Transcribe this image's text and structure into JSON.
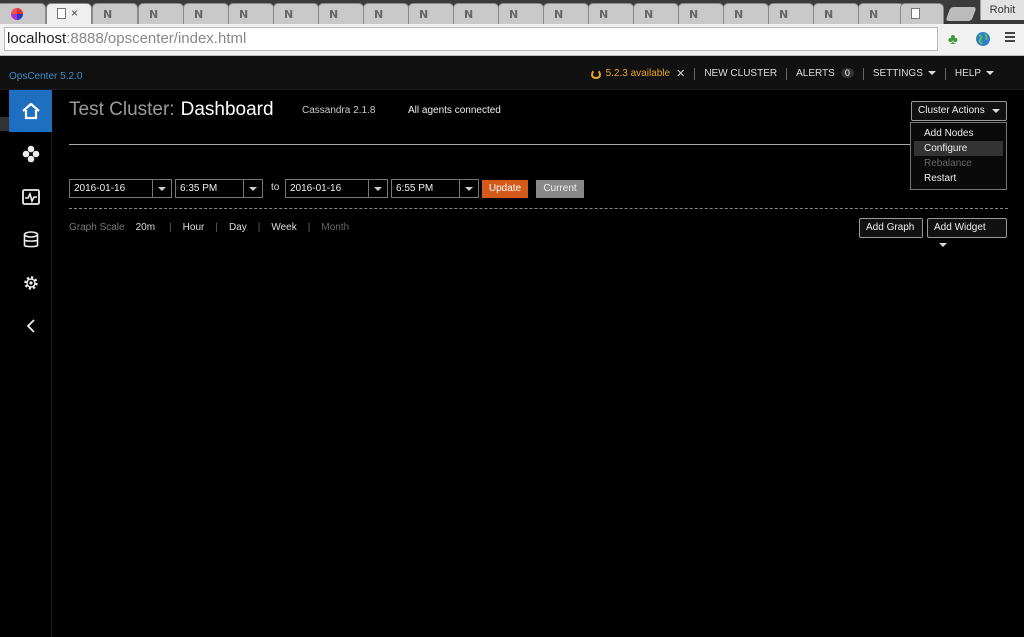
{
  "browser": {
    "tabs": [
      {
        "label": "N"
      },
      {
        "label": "N"
      },
      {
        "label": "N"
      },
      {
        "label": "N"
      },
      {
        "label": "N"
      },
      {
        "label": "N"
      },
      {
        "label": "N"
      },
      {
        "label": "N"
      },
      {
        "label": "N"
      },
      {
        "label": "N"
      },
      {
        "label": "N"
      },
      {
        "label": "N"
      },
      {
        "label": "N"
      },
      {
        "label": "N"
      },
      {
        "label": "N"
      },
      {
        "label": "N"
      },
      {
        "label": "N"
      },
      {
        "label": "N"
      },
      {
        "label": "N"
      }
    ],
    "active_tab_close": "×",
    "profile": "Rohit",
    "url_host": "localhost",
    "url_rest": ":8888/opscenter/index.html"
  },
  "topbar": {
    "brand": "OpsCenter 5.2.0",
    "update_available": "5.2.3 available",
    "update_close": "✕",
    "new_cluster": "NEW CLUSTER",
    "alerts": "ALERTS",
    "alerts_count": "0",
    "settings": "SETTINGS",
    "help": "HELP"
  },
  "sidebar": {
    "items": [
      {
        "icon": "home-icon"
      },
      {
        "icon": "nodes-icon"
      },
      {
        "icon": "activity-icon"
      },
      {
        "icon": "database-icon"
      },
      {
        "icon": "gear-icon"
      },
      {
        "icon": "chevron-left-icon"
      }
    ],
    "active_color": "#1f6fc0"
  },
  "header": {
    "cluster_name": "Test Cluster:",
    "page": "Dashboard",
    "cassandra_version": "Cassandra 2.1.8",
    "agents_status": "All agents connected"
  },
  "cluster_actions": {
    "label": "Cluster Actions",
    "menu": [
      {
        "label": "Add Nodes",
        "state": "normal"
      },
      {
        "label": "Configure",
        "state": "highlighted"
      },
      {
        "label": "Rebalance",
        "state": "disabled"
      },
      {
        "label": "Restart",
        "state": "normal"
      }
    ]
  },
  "range": {
    "from_date": "2016-01-16",
    "from_time": "6:35 PM",
    "to_label": "to",
    "to_date": "2016-01-16",
    "to_time": "6:55 PM",
    "update": "Update",
    "current": "Current",
    "update_color": "#d35a1a"
  },
  "graph_scale": {
    "label": "Graph Scale",
    "options": [
      "20m",
      "Hour",
      "Day",
      "Week",
      "Month"
    ],
    "selected": "20m"
  },
  "graph_buttons": {
    "add_graph": "Add Graph",
    "add_widget": "Add Widget"
  }
}
